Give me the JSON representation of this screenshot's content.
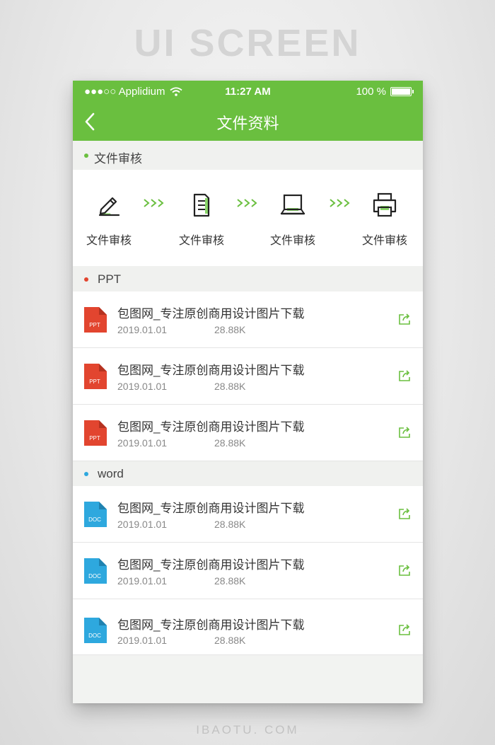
{
  "banner": {
    "headline": "UI SCREEN",
    "footer": "IBAOTU. COM"
  },
  "status_bar": {
    "carrier": "●●●○○ Applidium",
    "time": "11:27 AM",
    "battery": "100 %",
    "battery_level": 1.0
  },
  "nav": {
    "title": "文件资料",
    "back_icon": "chevron-left-icon"
  },
  "colors": {
    "accent": "#6abf3f",
    "ppt": "#e2452f",
    "doc": "#2ea8de",
    "ppt_dot": "#e2452f",
    "doc_dot": "#2ea8de",
    "review_dot": "#6abf3f"
  },
  "review": {
    "section_title": "文件审核",
    "steps": [
      {
        "label": "文件审核",
        "icon": "pen-icon"
      },
      {
        "label": "文件审核",
        "icon": "document-icon"
      },
      {
        "label": "文件审核",
        "icon": "laptop-icon"
      },
      {
        "label": "文件审核",
        "icon": "printer-icon"
      }
    ]
  },
  "ppt_section": {
    "title": "PPT",
    "badge": "PPT",
    "files": [
      {
        "name": "包图网_专注原创商用设计图片下载",
        "date": "2019.01.01",
        "size": "28.88K"
      },
      {
        "name": "包图网_专注原创商用设计图片下载",
        "date": "2019.01.01",
        "size": "28.88K"
      },
      {
        "name": "包图网_专注原创商用设计图片下载",
        "date": "2019.01.01",
        "size": "28.88K"
      }
    ]
  },
  "word_section": {
    "title": "word",
    "badge": "DOC",
    "files": [
      {
        "name": "包图网_专注原创商用设计图片下载",
        "date": "2019.01.01",
        "size": "28.88K"
      },
      {
        "name": "包图网_专注原创商用设计图片下载",
        "date": "2019.01.01",
        "size": "28.88K"
      },
      {
        "name": "包图网_专注原创商用设计图片下载",
        "date": "2019.01.01",
        "size": "28.88K"
      }
    ]
  }
}
